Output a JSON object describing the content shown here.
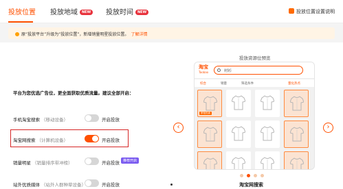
{
  "tabs": [
    {
      "label": "投放位置",
      "active": true,
      "badge": ""
    },
    {
      "label": "投放地域",
      "active": false,
      "badge": "NEW"
    },
    {
      "label": "投放时间",
      "active": false,
      "badge": "NEW"
    }
  ],
  "settings_label": "投放位置设置说明",
  "notice": {
    "text": "原“投放平台”升级为“投放位置”，新增销量明星投放位置。",
    "link": "了解详情"
  },
  "headline": "平台为您优选广告位，更全面获取优质流量。建议全部开启：",
  "rows": [
    {
      "name": "手机淘宝搜索",
      "sub": "（移动设备）",
      "on": false,
      "status": "开启投放"
    },
    {
      "name": "淘宝网搜索",
      "sub": "（计算机设备）",
      "on": true,
      "status": "开启投放"
    },
    {
      "name": "销量明星",
      "sub": "（销量排序带冲榜）",
      "on": false,
      "status": "开启投放",
      "badge": "推荐开启"
    },
    {
      "name": "站外优质媒体",
      "sub": "（站外人群种草设备）",
      "on": false,
      "status": "开启投放"
    }
  ],
  "preview": {
    "title": "投放资源位预览",
    "logo": "淘宝",
    "logo_sub": "Taobao",
    "search_text": "衬衫",
    "filters": [
      "综合",
      "销量",
      "筛选条件",
      "量化热点"
    ],
    "tag": "掌柜热卖",
    "caption": "淘宝网搜索",
    "current_page": 2,
    "page_count": 4
  },
  "colors": {
    "accent": "#ff5000",
    "highlight": "#d62525",
    "badge_purple": "#7b5cf0"
  }
}
